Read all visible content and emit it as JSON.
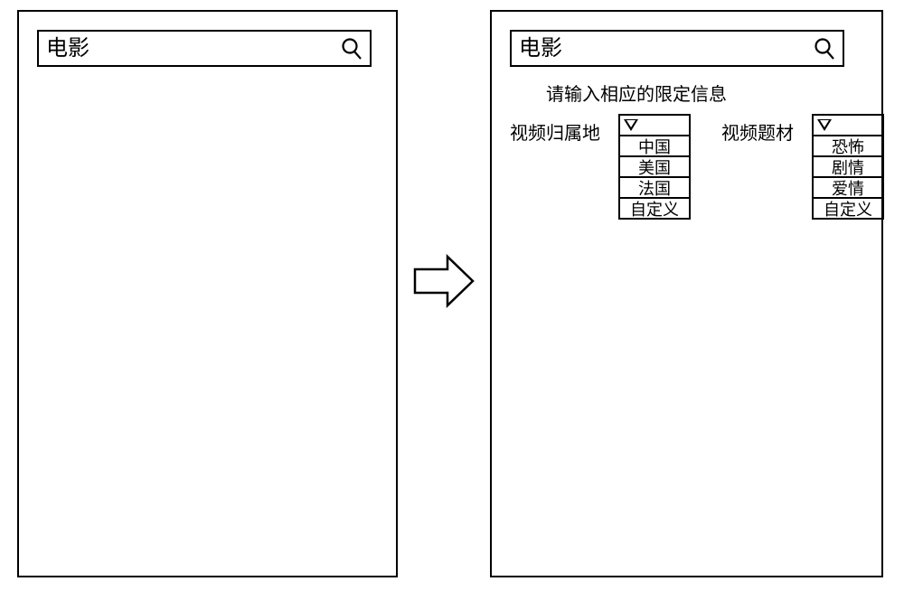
{
  "left": {
    "search": {
      "value": "电影"
    }
  },
  "right": {
    "search": {
      "value": "电影"
    },
    "prompt": "请输入相应的限定信息",
    "filter_region": {
      "label": "视频归属地",
      "options": [
        "中国",
        "美国",
        "法国",
        "自定义"
      ]
    },
    "filter_genre": {
      "label": "视频题材",
      "options": [
        "恐怖",
        "剧情",
        "爱情",
        "自定义"
      ]
    }
  }
}
